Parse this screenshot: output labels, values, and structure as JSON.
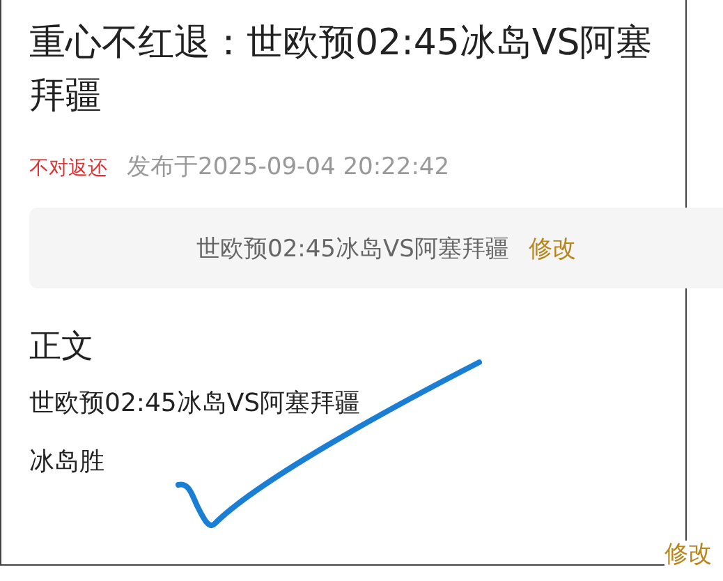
{
  "title": "重心不红退：世欧预02:45冰岛VS阿塞拜疆",
  "meta": {
    "tag": "不对返还",
    "published": "发布于2025-09-04 20:22:42"
  },
  "summary_card": {
    "text": "世欧预02:45冰岛VS阿塞拜疆",
    "edit_link": "修改"
  },
  "section_heading": "正文",
  "body": [
    "世欧预02:45冰岛VS阿塞拜疆",
    "冰岛胜"
  ],
  "footer_link": "修改"
}
